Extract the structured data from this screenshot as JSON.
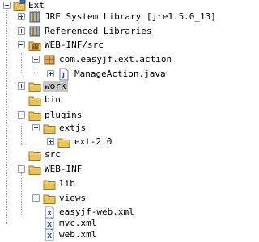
{
  "tree": {
    "items": [
      {
        "label": "Ext",
        "icon": "project-icon"
      },
      {
        "label": "JRE System Library [jre1.5.0_13]",
        "icon": "library-icon"
      },
      {
        "label": "Referenced Libraries",
        "icon": "library-icon"
      },
      {
        "label": "WEB-INF/src",
        "icon": "source-folder-icon"
      },
      {
        "label": "com.easyjf.ext.action",
        "icon": "package-icon"
      },
      {
        "label": "ManageAction.java",
        "icon": "java-file-icon"
      },
      {
        "label": "work",
        "icon": "folder-icon",
        "selected": true
      },
      {
        "label": "bin",
        "icon": "folder-icon"
      },
      {
        "label": "plugins",
        "icon": "folder-icon"
      },
      {
        "label": "extjs",
        "icon": "folder-icon"
      },
      {
        "label": "ext-2.0",
        "icon": "folder-icon"
      },
      {
        "label": "src",
        "icon": "folder-icon"
      },
      {
        "label": "WEB-INF",
        "icon": "folder-icon"
      },
      {
        "label": "lib",
        "icon": "folder-icon"
      },
      {
        "label": "views",
        "icon": "folder-icon"
      },
      {
        "label": "easyjf-web.xml",
        "icon": "xml-file-icon"
      },
      {
        "label": "mvc.xml",
        "icon": "xml-file-icon"
      },
      {
        "label": "web.xml",
        "icon": "xml-file-icon"
      }
    ]
  },
  "colors": {
    "folder": "#e8c25a",
    "selection": "#c8c8c8",
    "tree_line": "#a0a0a0"
  }
}
